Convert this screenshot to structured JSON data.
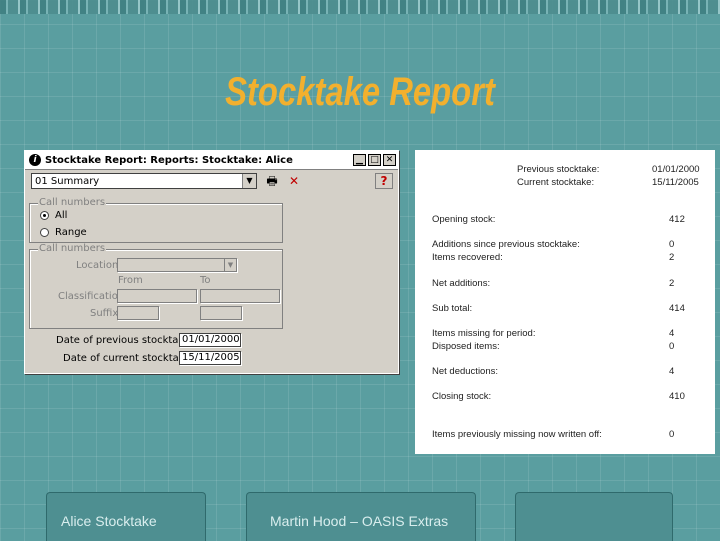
{
  "slide": {
    "title": "Stocktake Report",
    "title_color": "#f2b02e",
    "background_color": "#5a9ea0"
  },
  "dialog": {
    "title": "Stocktake Report: Reports: Stocktake: Alice",
    "title_icon": "info-icon",
    "report_select": "01 Summary",
    "call_numbers_group_1": {
      "label": "Call numbers",
      "options": [
        "All",
        "Range"
      ],
      "selected": "All"
    },
    "call_numbers_group_2": {
      "label": "Call numbers",
      "location_label": "Location",
      "from_label": "From",
      "to_label": "To",
      "classification_label": "Classification",
      "suffix_label": "Suffix"
    },
    "previous_date_label": "Date of previous stocktake",
    "previous_date_value": "01/01/2000",
    "current_date_label": "Date of current stocktake",
    "current_date_value": "15/11/2005"
  },
  "report": {
    "previous_label": "Previous stocktake:",
    "previous_value": "01/01/2000",
    "current_label": "Current stocktake:",
    "current_value": "15/11/2005",
    "rows": [
      {
        "label": "Opening stock:",
        "value": "412"
      },
      {
        "label": "Additions since previous stocktake:",
        "value": "0"
      },
      {
        "label": "Items recovered:",
        "value": "2"
      },
      {
        "label": "Net additions:",
        "value": "2"
      },
      {
        "label": "Sub total:",
        "value": "414"
      },
      {
        "label": "Items missing for period:",
        "value": "4"
      },
      {
        "label": "Disposed items:",
        "value": "0"
      },
      {
        "label": "Net deductions:",
        "value": "4"
      },
      {
        "label": "Closing stock:",
        "value": "410"
      },
      {
        "label": "Items previously missing now written off:",
        "value": "0"
      }
    ]
  },
  "footer": {
    "left": "Alice Stocktake",
    "middle": "Martin Hood – OASIS Extras",
    "right": ""
  }
}
